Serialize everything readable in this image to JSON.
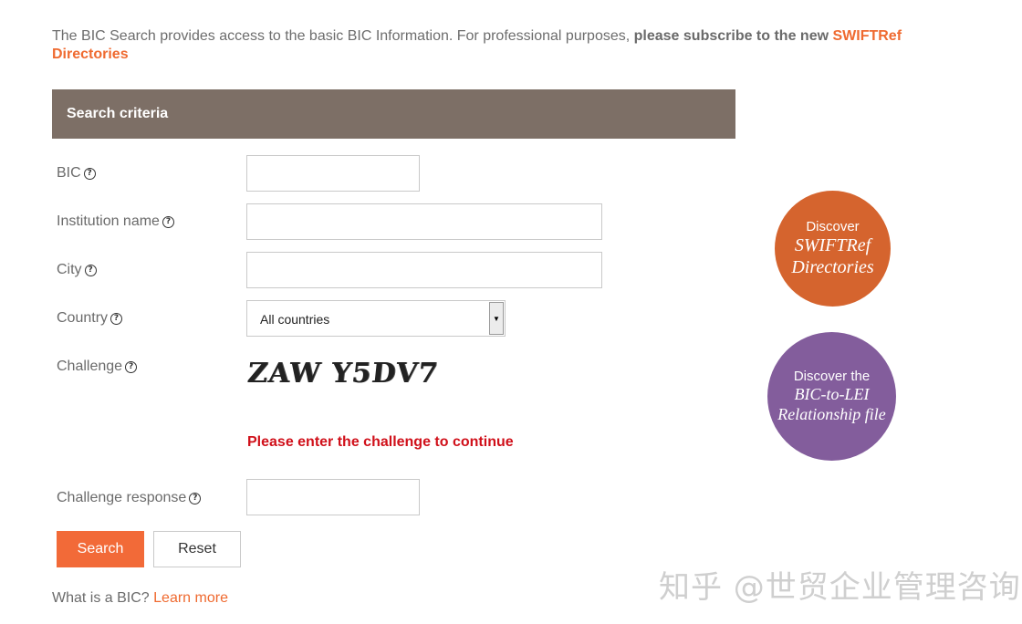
{
  "intro": {
    "text": "The BIC Search provides access to the basic BIC Information. For professional purposes, ",
    "bold": "please subscribe to the new ",
    "link": "SWIFTRef Directories"
  },
  "panel": {
    "title": "Search criteria"
  },
  "form": {
    "bic_label": "BIC",
    "bic_value": "",
    "institution_label": "Institution name",
    "institution_value": "",
    "city_label": "City",
    "city_value": "",
    "country_label": "Country",
    "country_selected": "All countries",
    "challenge_label": "Challenge",
    "captcha_text": "ZAW Y5DV7",
    "challenge_message": "Please enter the challenge to continue",
    "challenge_response_label": "Challenge response",
    "challenge_response_value": ""
  },
  "buttons": {
    "search": "Search",
    "reset": "Reset"
  },
  "footer": {
    "question": "What is a BIC? ",
    "learn_more": "Learn more"
  },
  "promo": {
    "swiftref": {
      "line1": "Discover",
      "line2": "SWIFTRef",
      "line3": "Directories"
    },
    "lei": {
      "line1": "Discover the",
      "line2": "BIC-to-LEI",
      "line3": "Relationship file"
    }
  },
  "watermark": "知乎 @世贸企业管理咨询",
  "colors": {
    "accent": "#f26a38",
    "header_bg": "#7d6f66",
    "error": "#d0101a",
    "promo_orange": "#d5642e",
    "promo_purple": "#835d9c"
  }
}
